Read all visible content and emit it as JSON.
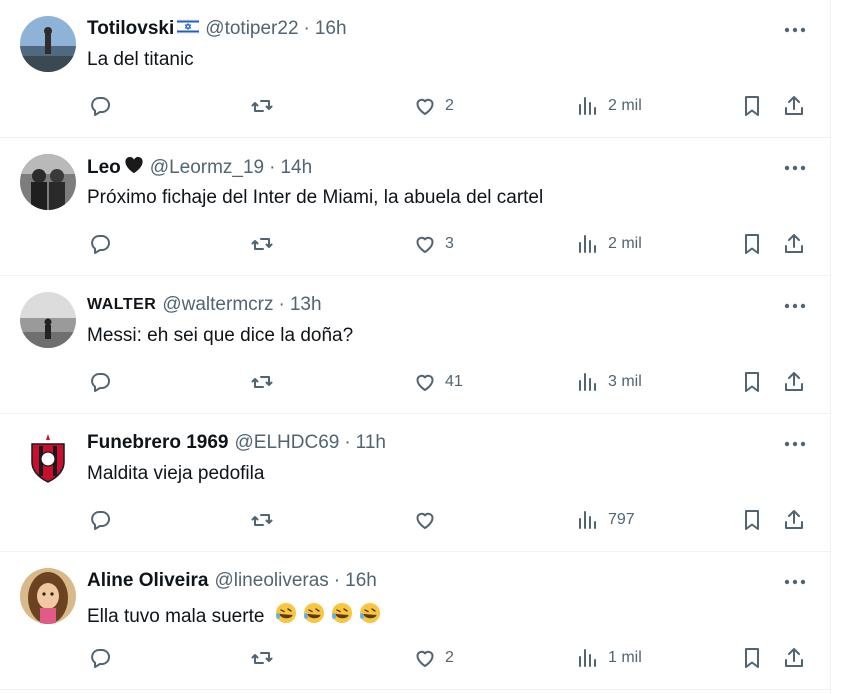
{
  "tweets": [
    {
      "name": "Totilovski",
      "handle": "@totiper22",
      "time": "16h",
      "text": "La del titanic",
      "reply_count": "",
      "retweet_count": "",
      "like_count": "2",
      "views": "2 mil"
    },
    {
      "name": "Leo",
      "handle": "@Leormz_19",
      "time": "14h",
      "text": "Próximo fichaje del Inter de Miami, la abuela del cartel",
      "reply_count": "",
      "retweet_count": "",
      "like_count": "3",
      "views": "2 mil"
    },
    {
      "name": "WALTER",
      "handle": "@waltermcrz",
      "time": "13h",
      "text": "Messi: eh sei que dice la doña?",
      "reply_count": "",
      "retweet_count": "",
      "like_count": "41",
      "views": "3 mil"
    },
    {
      "name": "Funebrero 1969",
      "handle": "@ELHDC69",
      "time": "11h",
      "text": "Maldita vieja pedofila",
      "reply_count": "",
      "retweet_count": "",
      "like_count": "",
      "views": "797"
    },
    {
      "name": "Aline Oliveira",
      "handle": "@lineoliveras",
      "time": "16h",
      "text": "Ella tuvo mala suerte",
      "reply_count": "",
      "retweet_count": "",
      "like_count": "2",
      "views": "1 mil"
    }
  ],
  "separator": "·",
  "icons": {
    "reply": "reply-icon",
    "retweet": "retweet-icon",
    "like": "like-icon",
    "views": "views-icon",
    "bookmark": "bookmark-icon",
    "share": "share-icon",
    "more": "more-icon",
    "flag_emoji": "israel-flag-icon",
    "heart_emoji": "black-heart-icon",
    "laughing_emoji": "rolling-on-floor-laughing-icon"
  },
  "colors": {
    "text": "#0f1419",
    "secondary": "#536471",
    "border": "#eff3f4",
    "emoji": "#f7c63e"
  }
}
